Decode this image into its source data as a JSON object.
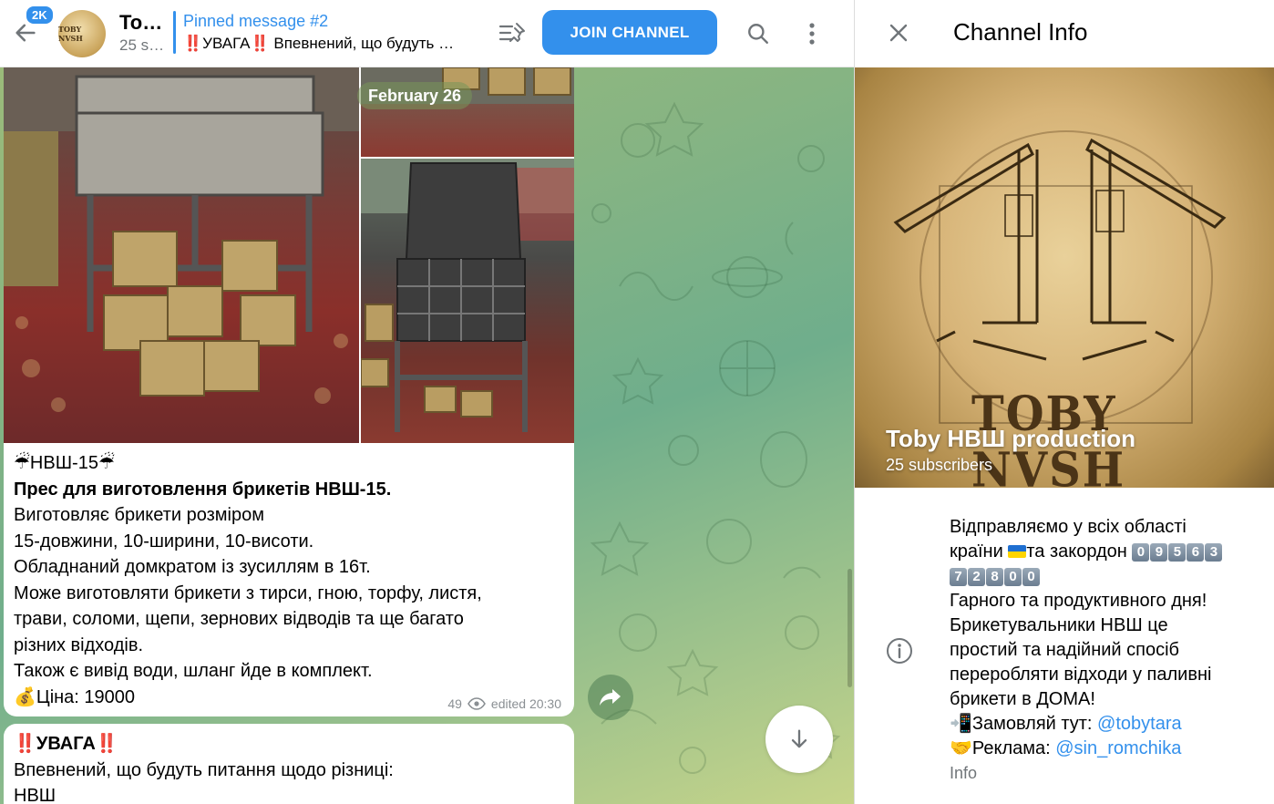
{
  "header": {
    "unread_count": "2K",
    "channel_title": "To…",
    "channel_subtitle": "25 s…",
    "avatar_text": "TOBY NVSH",
    "pinned_title": "Pinned message #2",
    "pinned_text": "‼️УВАГА‼️ Впевнений, що будуть …",
    "join_label": "JOIN CHANNEL"
  },
  "chat": {
    "date_label": "February 26",
    "message1": {
      "line1": "☔НВШ-15☔",
      "line2": "Прес для виготовлення брикетів НВШ-15.",
      "line3": "Виготовляє брикети розміром",
      "line4": "15-довжини, 10-ширини, 10-висоти.",
      "line5": "Обладнаний домкратом із зусиллям в 16т.",
      "line6": "Може виготовляти брикети з тирси, гною, торфу, листя,",
      "line7": "трави, соломи, щепи, зернових відводів та ще багато",
      "line8": "різних відходів.",
      "line9": "Також є вивід води, шланг йде в комплект.",
      "line10": "💰Ціна: 19000",
      "views": "49",
      "edited": "edited 20:30"
    },
    "message2": {
      "line1": "‼️УВАГА‼️",
      "line2": "Впевнений, що будуть питання щодо різниці:",
      "line3": "НВШ"
    }
  },
  "sidebar": {
    "title": "Channel Info",
    "cover_logo": "TOBY NVSH",
    "channel_name": "Toby НВШ production",
    "subscribers": "25 subscribers",
    "about": {
      "l1": "Відправляємо у всіх області",
      "l2a": "країни ",
      "l2b": "та закордон ",
      "phone1": [
        "0",
        "9",
        "5",
        "6",
        "3"
      ],
      "phone2": [
        "7",
        "2",
        "8",
        "0",
        "0"
      ],
      "l3": "Гарного та продуктивного дня!",
      "l4": "Брикетувальники НВШ це",
      "l5": "простий та надійний спосіб",
      "l6": "переробляти відходи у паливні",
      "l7": "брикети в ДОМА!",
      "order_prefix": "📲Замовляй тут: ",
      "order_link": "@tobytara",
      "ad_prefix": "🤝Реклама: ",
      "ad_link": "@sin_romchika"
    },
    "info_label": "Info"
  },
  "colors": {
    "accent": "#3390ec",
    "muted": "#707579"
  }
}
